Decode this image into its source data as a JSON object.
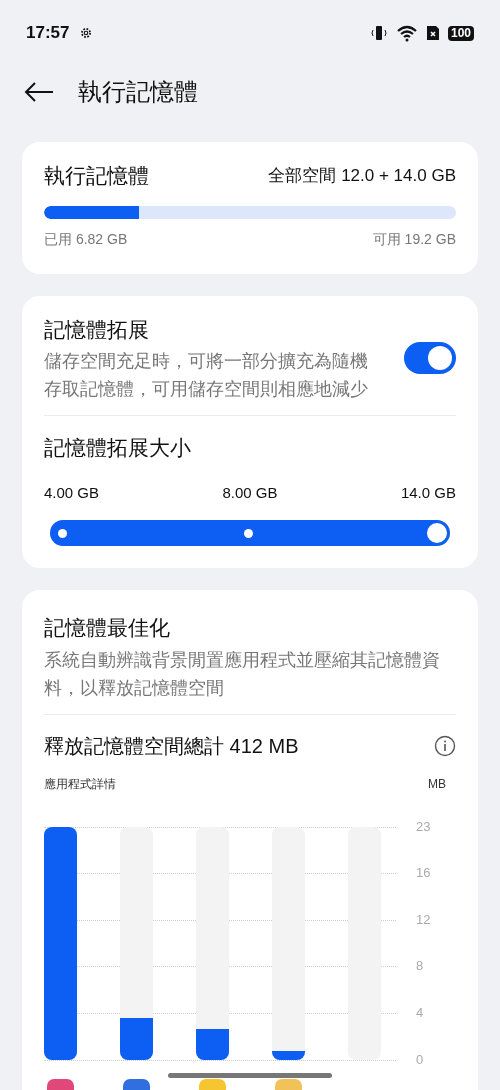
{
  "status_bar": {
    "time": "17:57",
    "battery": "100"
  },
  "header": {
    "title": "執行記憶體"
  },
  "memory_card": {
    "title": "執行記憶體",
    "total": "全部空間 12.0 + 14.0 GB",
    "usage": {
      "level": 0.23
    },
    "used": "已用 6.82 GB",
    "free": "可用 19.2 GB"
  },
  "expansion_card": {
    "title": "記憶體拓展",
    "description": "儲存空間充足時，可將一部分擴充為隨機存取記憶體，可用儲存空間則相應地減少",
    "toggle": {
      "on": true
    },
    "size_title": "記憶體拓展大小",
    "size_slider": {
      "stops": [
        {
          "label": "4.00 GB",
          "selected": false
        },
        {
          "label": "8.00 GB",
          "selected": false
        },
        {
          "label": "14.0 GB",
          "selected": true
        }
      ]
    }
  },
  "optimize_card": {
    "title": "記憶體最佳化",
    "description": "系統自動辨識背景閒置應用程式並壓縮其記憶體資料，以釋放記憶體空間",
    "freed": "釋放記憶體空間總計 412 MB",
    "chart_title": "應用程式詳情",
    "unit": "MB",
    "axis_labels": [
      "23",
      "16",
      "12",
      "8",
      "4",
      "0"
    ]
  }
}
